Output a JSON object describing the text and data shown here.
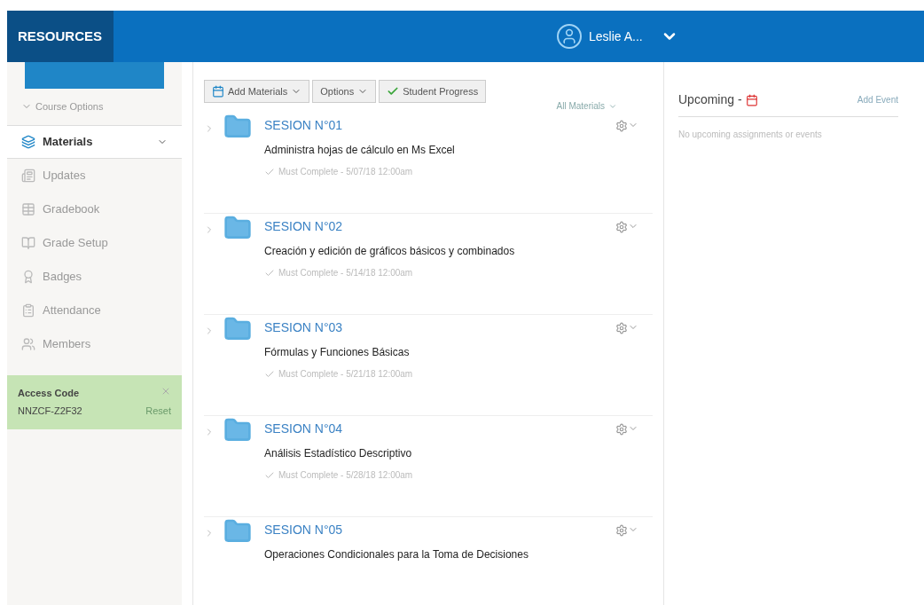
{
  "header": {
    "brand": "RESOURCES",
    "user": "Leslie A..."
  },
  "sidebar": {
    "course_options": "Course Options",
    "items": [
      {
        "label": "Materials",
        "selected": true
      },
      {
        "label": "Updates",
        "selected": false
      },
      {
        "label": "Gradebook",
        "selected": false
      },
      {
        "label": "Grade Setup",
        "selected": false
      },
      {
        "label": "Badges",
        "selected": false
      },
      {
        "label": "Attendance",
        "selected": false
      },
      {
        "label": "Members",
        "selected": false
      }
    ],
    "access_code": {
      "title": "Access Code",
      "code": "NNZCF-Z2F32",
      "reset": "Reset"
    }
  },
  "toolbar": {
    "buttons": [
      "Add Materials",
      "Options",
      "Student Progress"
    ],
    "filter": "All Materials"
  },
  "materials": [
    {
      "title": "SESION N°01",
      "description": "Administra hojas de cálculo en Ms Excel",
      "due": "Must Complete - 5/07/18 12:00am"
    },
    {
      "title": "SESION N°02",
      "description": "Creación y edición de gráficos básicos y combinados",
      "due": "Must Complete - 5/14/18 12:00am"
    },
    {
      "title": "SESION N°03",
      "description": "Fórmulas y Funciones Básicas",
      "due": "Must Complete - 5/21/18 12:00am"
    },
    {
      "title": "SESION N°04",
      "description": "Análisis Estadístico Descriptivo",
      "due": "Must Complete - 5/28/18 12:00am"
    },
    {
      "title": "SESION N°05",
      "description": "Operaciones Condicionales para la Toma de Decisiones"
    }
  ],
  "upcoming": {
    "title": "Upcoming -",
    "add_event": "Add Event",
    "empty": "No upcoming assignments or events"
  }
}
